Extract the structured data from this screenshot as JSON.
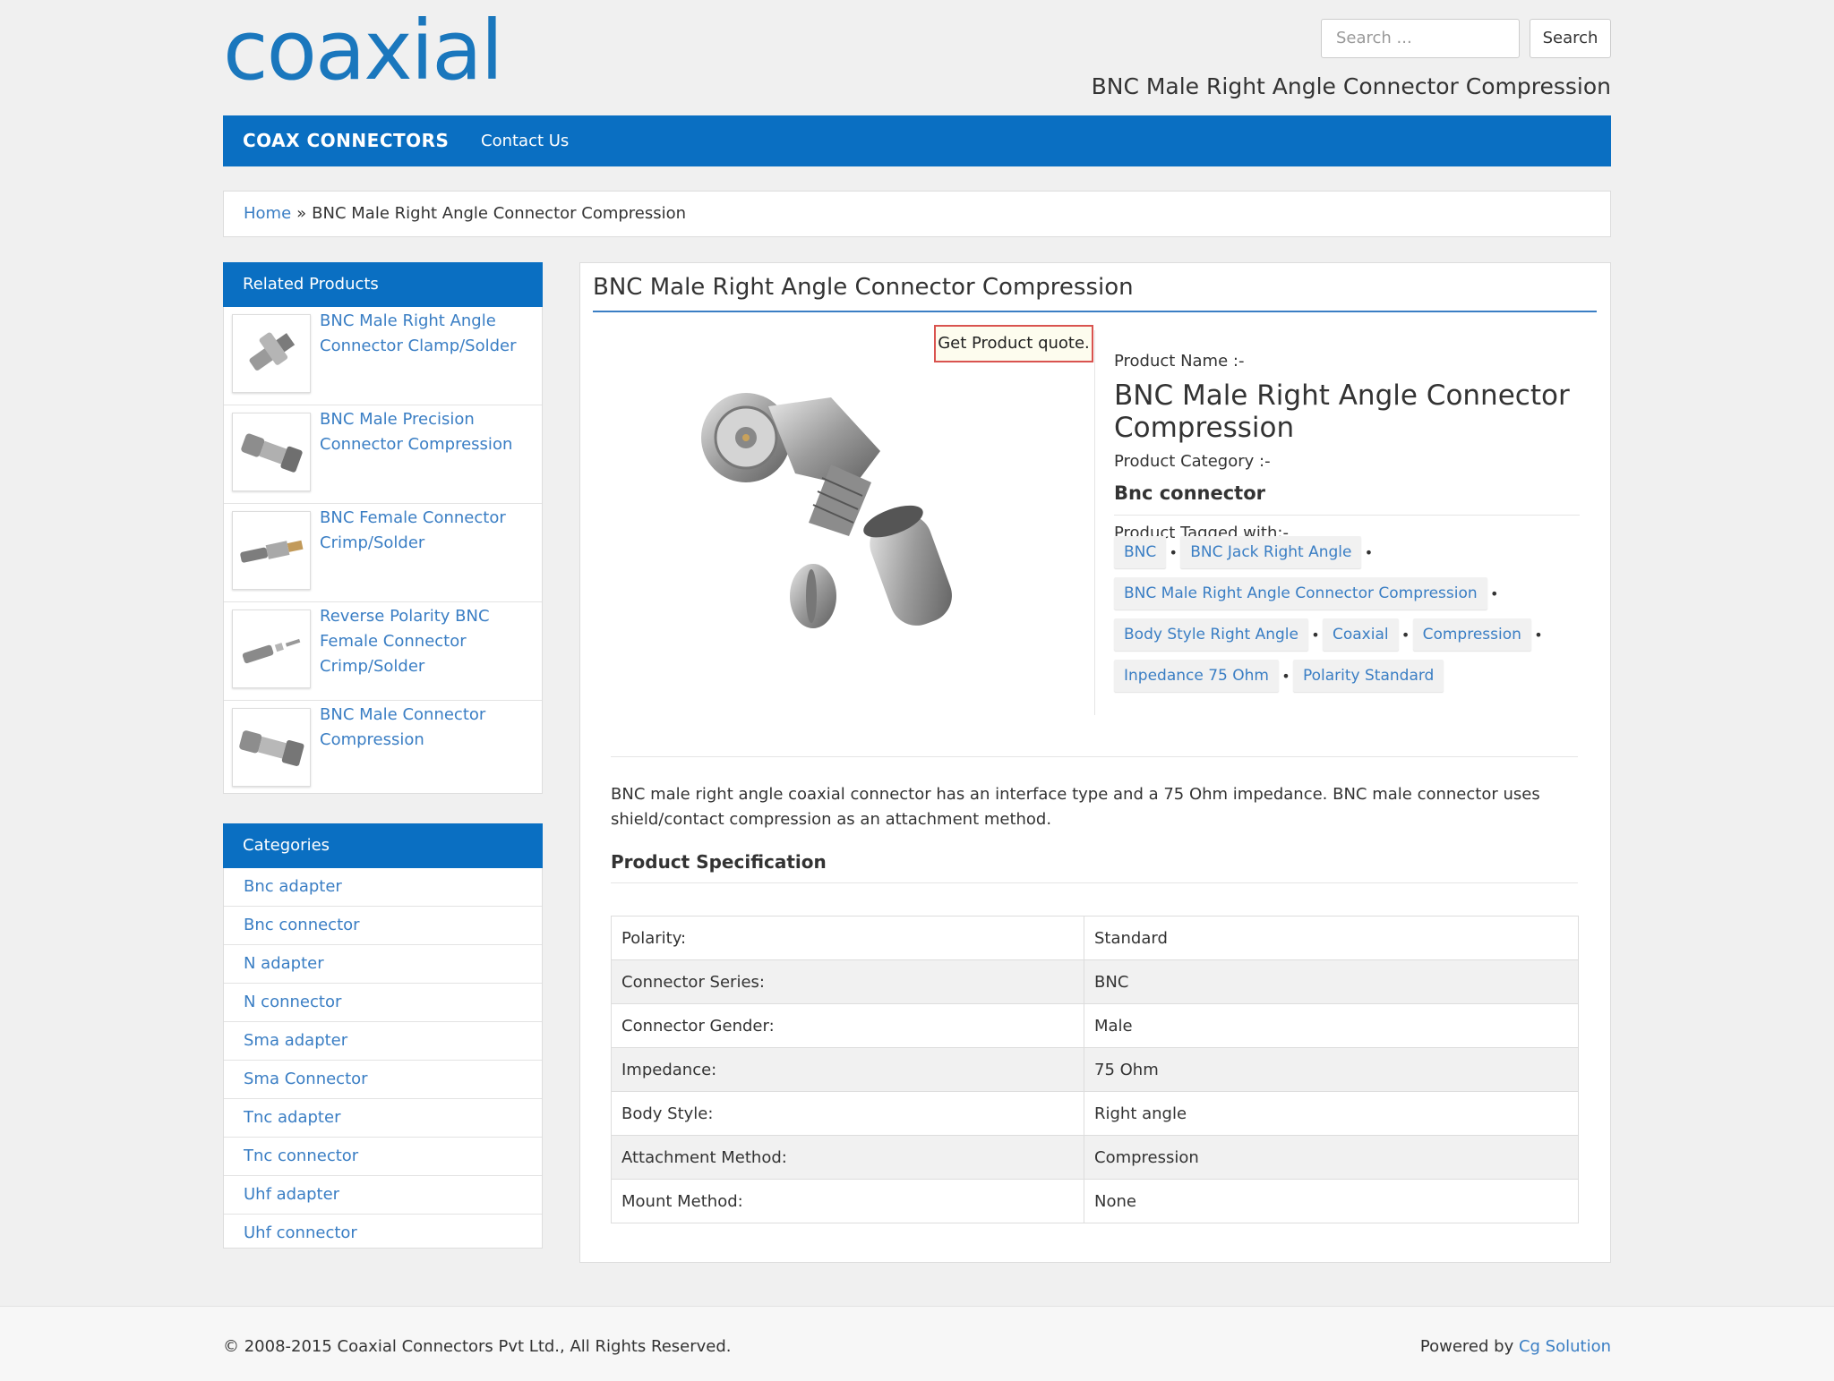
{
  "header": {
    "logo_text": "coaxial",
    "search_placeholder": "Search ...",
    "search_button": "Search",
    "title": "BNC Male Right Angle Connector Compression"
  },
  "nav": {
    "brand": "COAX CONNECTORS",
    "contact": "Contact Us"
  },
  "breadcrumb": {
    "home": "Home",
    "separator": "»",
    "current": "BNC Male Right Angle Connector Compression"
  },
  "related": {
    "heading": "Related Products",
    "items": [
      {
        "name": "BNC Male Right Angle Connector Clamp/Solder"
      },
      {
        "name": "BNC Male Precision Connector Compression"
      },
      {
        "name": "BNC Female Connector Crimp/Solder"
      },
      {
        "name": "Reverse Polarity BNC Female Connector Crimp/Solder"
      },
      {
        "name": "BNC Male Connector Compression"
      }
    ]
  },
  "categories": {
    "heading": "Categories",
    "items": [
      "Bnc adapter",
      "Bnc connector",
      "N adapter",
      "N connector",
      "Sma adapter",
      "Sma Connector",
      "Tnc adapter",
      "Tnc connector",
      "Uhf adapter",
      "Uhf connector"
    ]
  },
  "product": {
    "title": "BNC Male Right Angle Connector Compression",
    "quote_button": "Get Product quote.",
    "name_label": "Product Name :-",
    "name": "BNC Male Right Angle Connector Compression",
    "category_label": "Product Category :-",
    "category": "Bnc connector",
    "tags_label": "Product Tagged with:-",
    "tags": [
      "BNC",
      "BNC Jack Right Angle",
      "BNC Male Right Angle Connector Compression",
      "Body Style Right Angle",
      "Coaxial",
      "Compression",
      "Inpedance 75 Ohm",
      "Polarity Standard"
    ],
    "description": "BNC male right angle coaxial connector has an interface type and a 75 Ohm impedance. BNC male connector uses shield/contact compression as an attachment method.",
    "spec_title": "Product Specification",
    "specs": [
      {
        "key": "Polarity:",
        "value": "Standard"
      },
      {
        "key": "Connector Series:",
        "value": "BNC"
      },
      {
        "key": "Connector Gender:",
        "value": "Male"
      },
      {
        "key": "Impedance:",
        "value": "75 Ohm"
      },
      {
        "key": "Body Style:",
        "value": "Right angle"
      },
      {
        "key": "Attachment Method:",
        "value": "Compression"
      },
      {
        "key": "Mount Method:",
        "value": "None"
      }
    ]
  },
  "footer": {
    "copyright": "© 2008-2015 Coaxial Connectors Pvt Ltd., All Rights Reserved.",
    "powered_prefix": "Powered by ",
    "powered_link": "Cg Solution"
  },
  "colors": {
    "brand_blue": "#0a6fc2",
    "link_blue": "#3a7ec4",
    "quote_border": "#d9534f"
  }
}
